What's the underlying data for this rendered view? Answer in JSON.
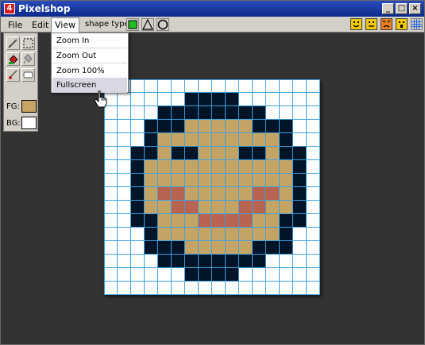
{
  "window": {
    "title": "Pixelshop",
    "app_icon_glyph": "4",
    "controls": [
      "_",
      "□",
      "×"
    ]
  },
  "menubar": {
    "file": "File",
    "edit": "Edit",
    "view": "View",
    "shape_type_label": "shape type:",
    "shape_icons": [
      "filled-square-icon",
      "triangle-icon",
      "circle-icon"
    ],
    "right_icons": [
      "smiley-happy-icon",
      "smiley-neutral-icon",
      "smiley-angry-icon",
      "smiley-surprised-icon",
      "grid-icon"
    ]
  },
  "view_menu": {
    "items": [
      "Zoom In",
      "Zoom Out",
      "Zoom 100%",
      "Fullscreen"
    ],
    "hovered": "Fullscreen"
  },
  "toolbox": {
    "tools": [
      "pencil-icon",
      "select-icon",
      "fill-icon",
      "eyedropper-icon",
      "brush-icon",
      "eraser-icon"
    ],
    "fg_label": "FG:",
    "bg_label": "BG:",
    "fg_color": "#c8a464",
    "bg_color": "#ffffff"
  },
  "canvas": {
    "grid_size": 16,
    "palette": {
      "0": "#ffffff",
      "1": "#001428",
      "2": "#c4a464",
      "3": "#b86450"
    },
    "pixels": [
      "0000000000000000",
      "0000001111000000",
      "0000111111110000",
      "0001112222211100",
      "0001222222222100",
      "0011211222112110",
      "0012222222222210",
      "0012222222222210",
      "0012332222233210",
      "0012233222332210",
      "0011222333322110",
      "0001222222222100",
      "0001112222211100",
      "0000111111110000",
      "0000001111000000",
      "0000000000000000"
    ]
  },
  "colors": {
    "titlebar": "#0a2a8c",
    "background": "#333333",
    "chrome": "#d4d0c8"
  }
}
